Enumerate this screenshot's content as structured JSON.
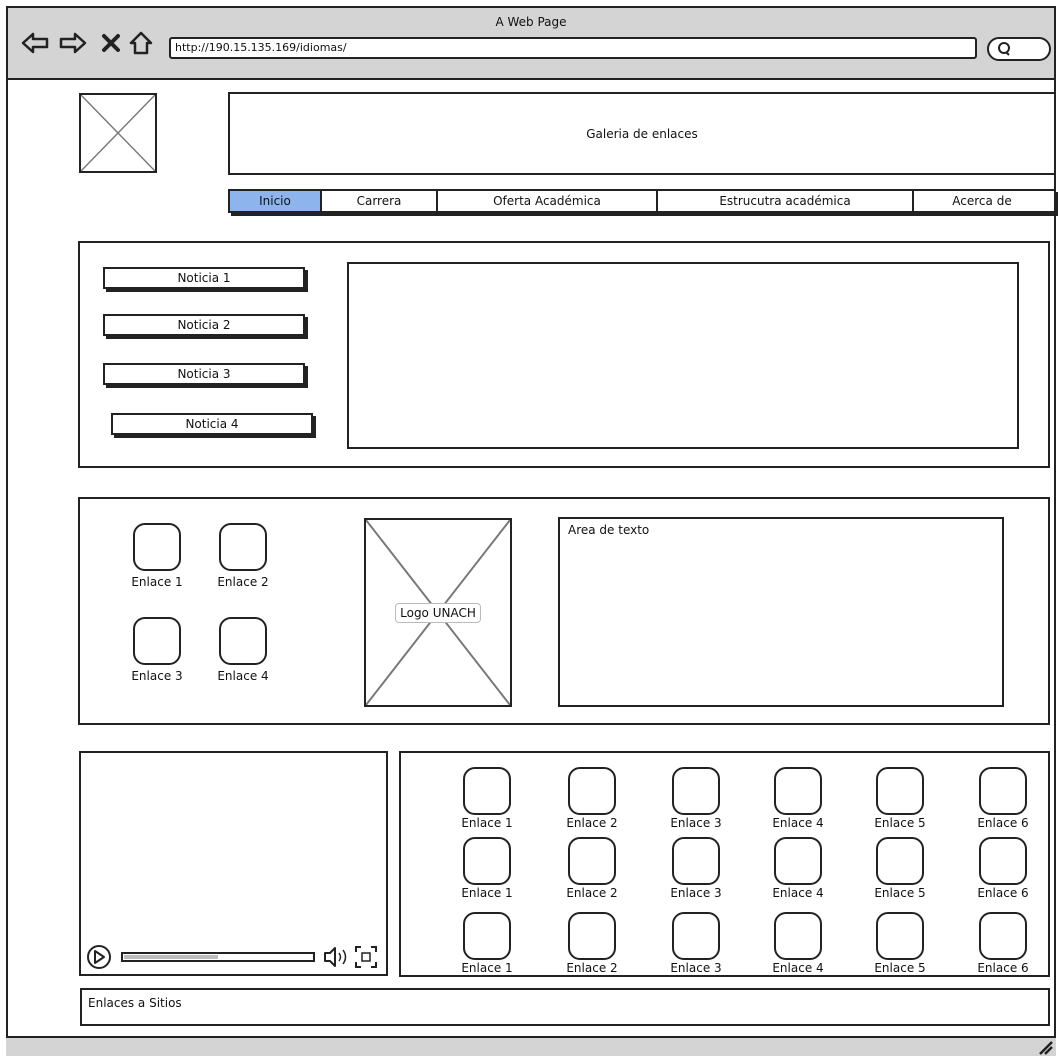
{
  "window": {
    "title": "A Web Page"
  },
  "browser": {
    "url": "http://190.15.135.169/idiomas/"
  },
  "header": {
    "banner_text": "Galeria de enlaces"
  },
  "nav": {
    "tabs": [
      {
        "label": "Inicio",
        "active": true
      },
      {
        "label": "Carrera"
      },
      {
        "label": "Oferta Académica"
      },
      {
        "label": "Estrucutra académica"
      },
      {
        "label": "Acerca de"
      }
    ]
  },
  "news": {
    "items": [
      "Noticia 1",
      "Noticia 2",
      "Noticia 3",
      "Noticia 4"
    ]
  },
  "middle": {
    "links": [
      "Enlace 1",
      "Enlace 2",
      "Enlace 3",
      "Enlace 4"
    ],
    "logo_label": "Logo UNACH",
    "text_area_label": "Area de texto"
  },
  "links_grid": {
    "rows": [
      [
        "Enlace 1",
        "Enlace 2",
        "Enlace 3",
        "Enlace 4",
        "Enlace 5",
        "Enlace 6"
      ],
      [
        "Enlace 1",
        "Enlace 2",
        "Enlace 3",
        "Enlace 4",
        "Enlace 5",
        "Enlace 6"
      ],
      [
        "Enlace 1",
        "Enlace 2",
        "Enlace 3",
        "Enlace 4",
        "Enlace 5",
        "Enlace 6"
      ]
    ]
  },
  "video": {
    "progress": 0.5
  },
  "footer": {
    "label": "Enlaces a Sitios"
  },
  "colors": {
    "active_tab": "#8eb4ee",
    "chrome": "#d4d4d4",
    "stroke": "#222222"
  }
}
